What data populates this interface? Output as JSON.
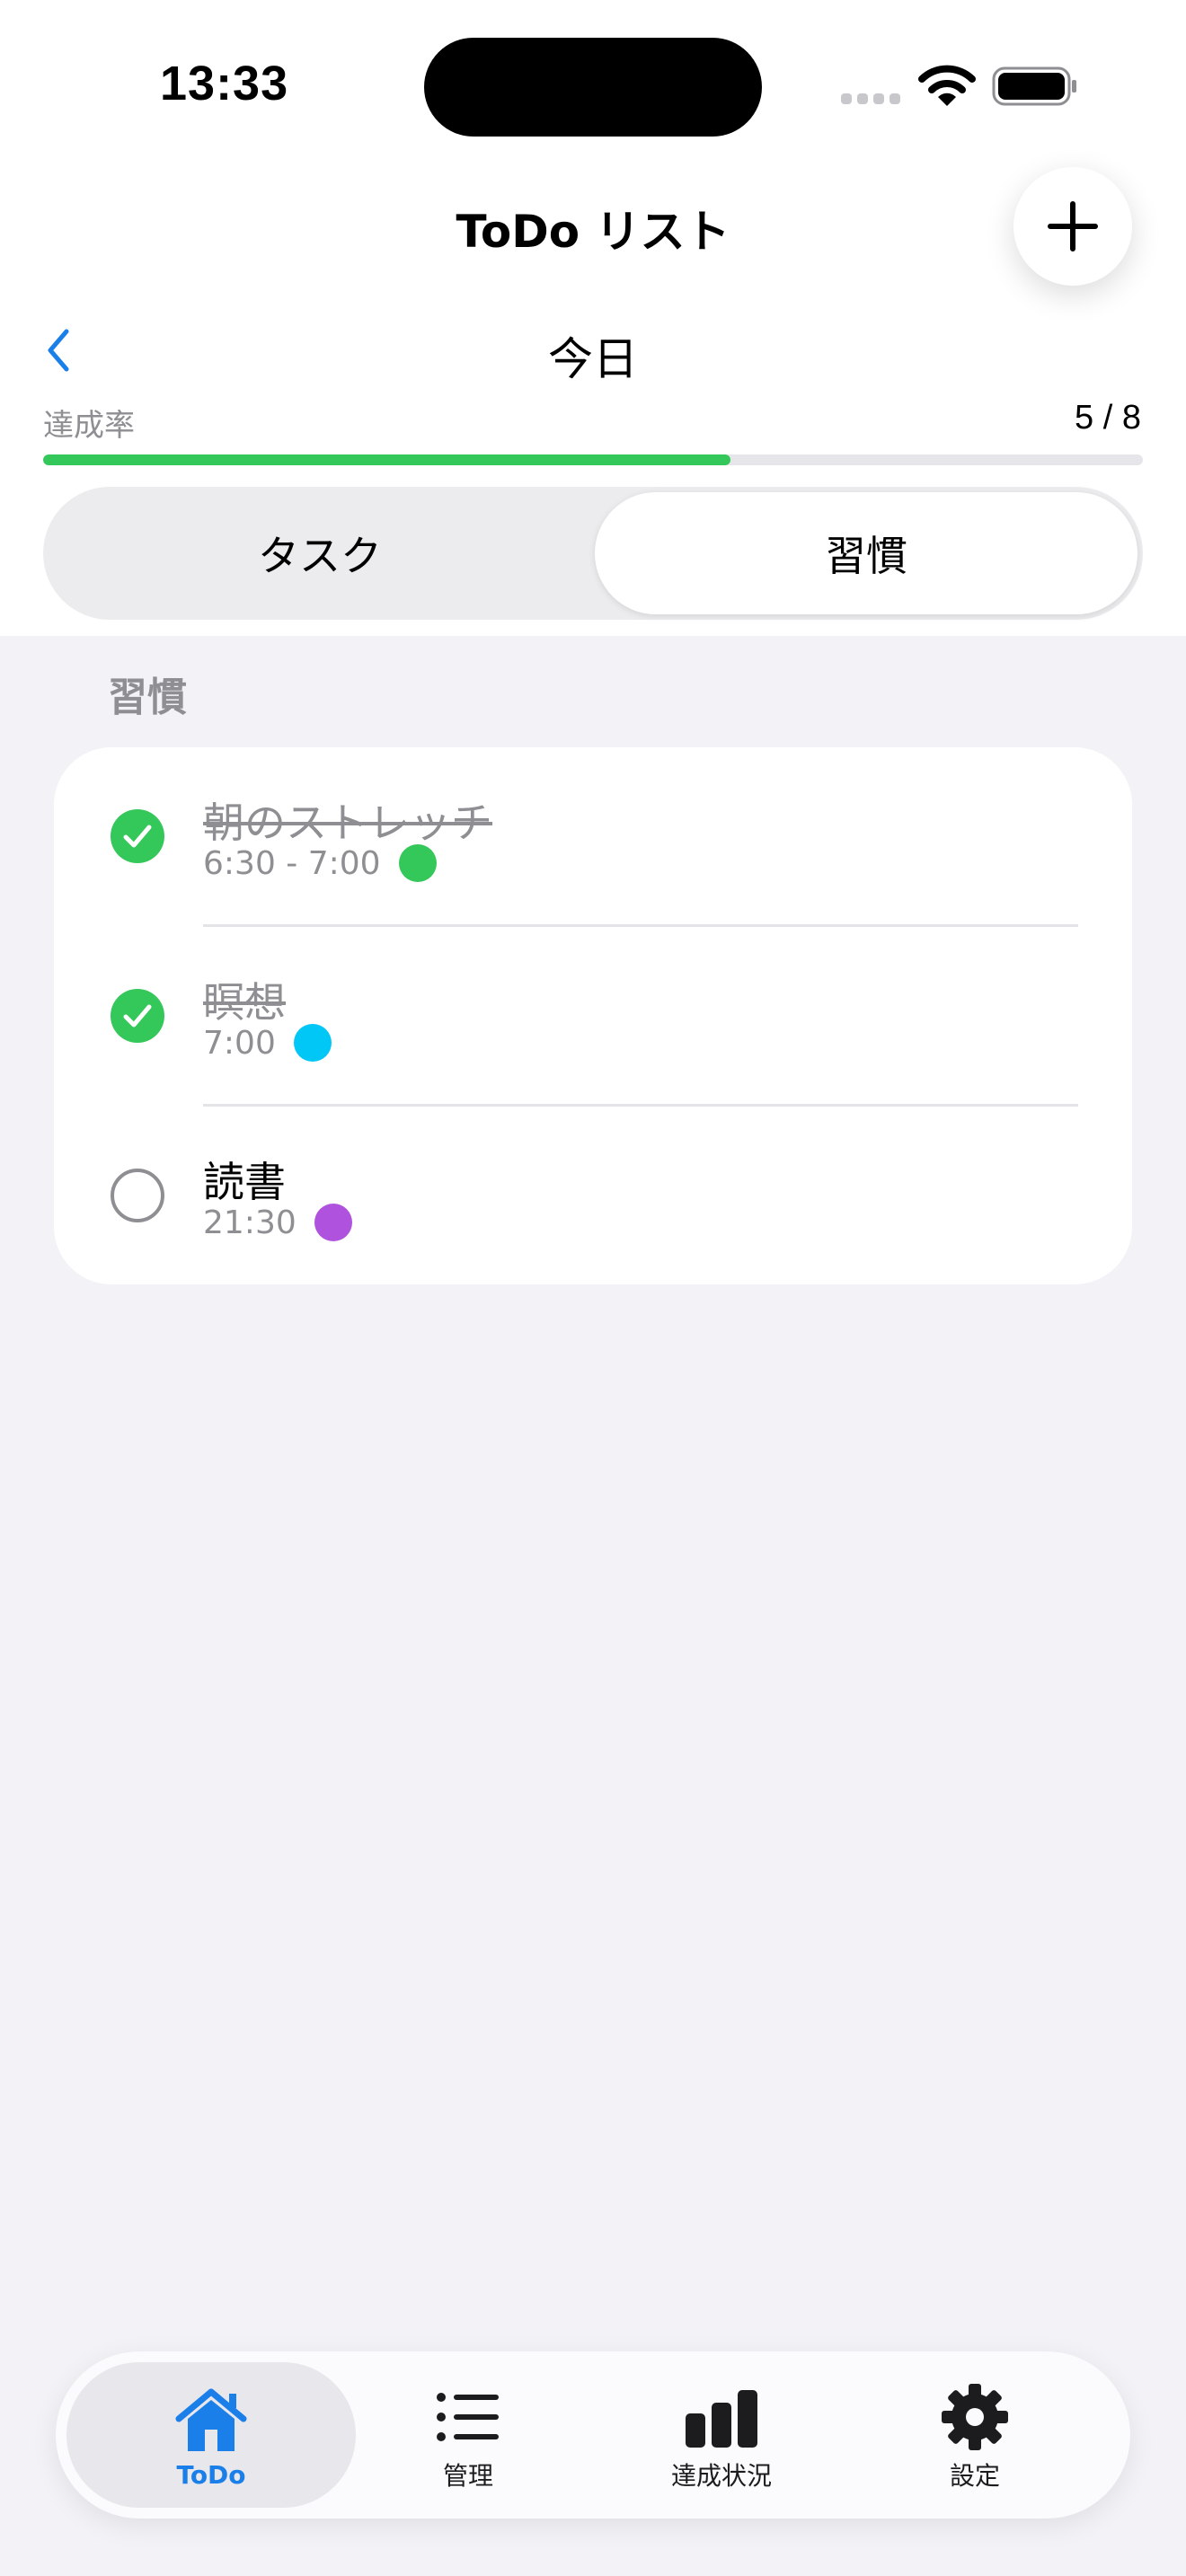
{
  "status_bar": {
    "time": "13:33"
  },
  "nav": {
    "title": "ToDo リスト"
  },
  "date_header": {
    "title": "今日"
  },
  "progress": {
    "label": "達成率",
    "value_text": "5 / 8",
    "done": 5,
    "total": 8,
    "accent": "#34c759"
  },
  "segments": [
    {
      "label": "タスク",
      "active": false
    },
    {
      "label": "習慣",
      "active": true
    }
  ],
  "habits": {
    "section_title": "習慣",
    "items": [
      {
        "name": "朝のストレッチ",
        "time": "6:30 - 7:00",
        "done": true,
        "color": "#34c759"
      },
      {
        "name": "瞑想",
        "time": "7:00",
        "done": true,
        "color": "#00c7f5"
      },
      {
        "name": "読書",
        "time": "21:30",
        "done": false,
        "color": "#af52de"
      }
    ]
  },
  "tabs": [
    {
      "label": "ToDo",
      "icon": "house-icon",
      "active": true
    },
    {
      "label": "管理",
      "icon": "list-icon",
      "active": false
    },
    {
      "label": "達成状況",
      "icon": "bar-chart-icon",
      "active": false
    },
    {
      "label": "設定",
      "icon": "gear-icon",
      "active": false
    }
  ]
}
